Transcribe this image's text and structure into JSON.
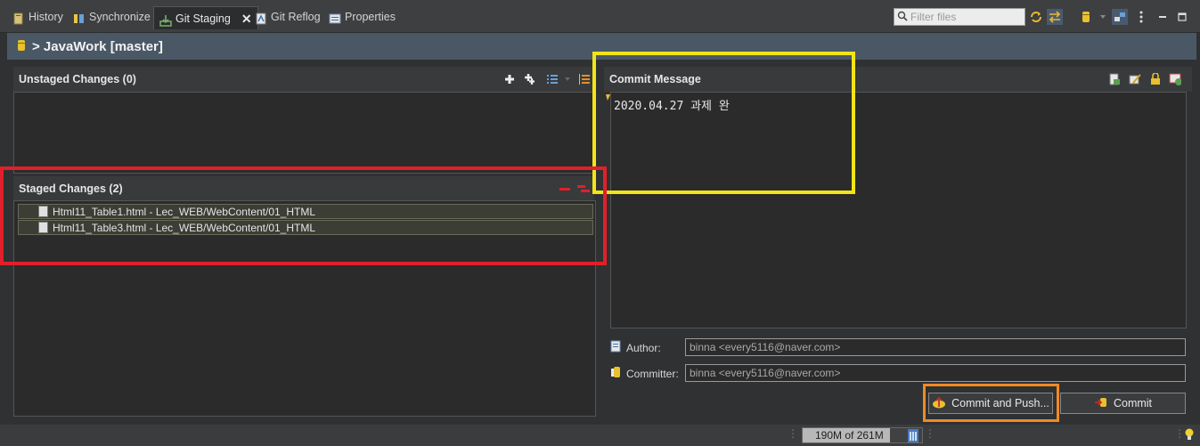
{
  "tabs": [
    {
      "label": "History"
    },
    {
      "label": "Synchronize"
    },
    {
      "label": "Git Staging"
    },
    {
      "label": "Git Reflog"
    },
    {
      "label": "Properties"
    }
  ],
  "filter": {
    "placeholder": "Filter files"
  },
  "repo": {
    "title": "> JavaWork [master]"
  },
  "unstaged": {
    "title": "Unstaged Changes (0)"
  },
  "staged": {
    "title": "Staged Changes (2)",
    "files": [
      "Html11_Table1.html - Lec_WEB/WebContent/01_HTML",
      "Html11_Table3.html - Lec_WEB/WebContent/01_HTML"
    ]
  },
  "commit": {
    "title": "Commit Message",
    "message": "2020.04.27 과제 완",
    "author_label": "Author:",
    "author_value": "binna <every5116@naver.com>",
    "committer_label": "Committer:",
    "committer_value": "binna <every5116@naver.com>",
    "commit_push_label": "Commit and Push...",
    "commit_label": "Commit"
  },
  "status": {
    "heap": "190M of 261M",
    "heap_used_fraction": 0.73
  },
  "colors": {
    "highlight_yellow": "#f2e416",
    "highlight_red": "#e0202a",
    "highlight_orange": "#f08a24"
  }
}
